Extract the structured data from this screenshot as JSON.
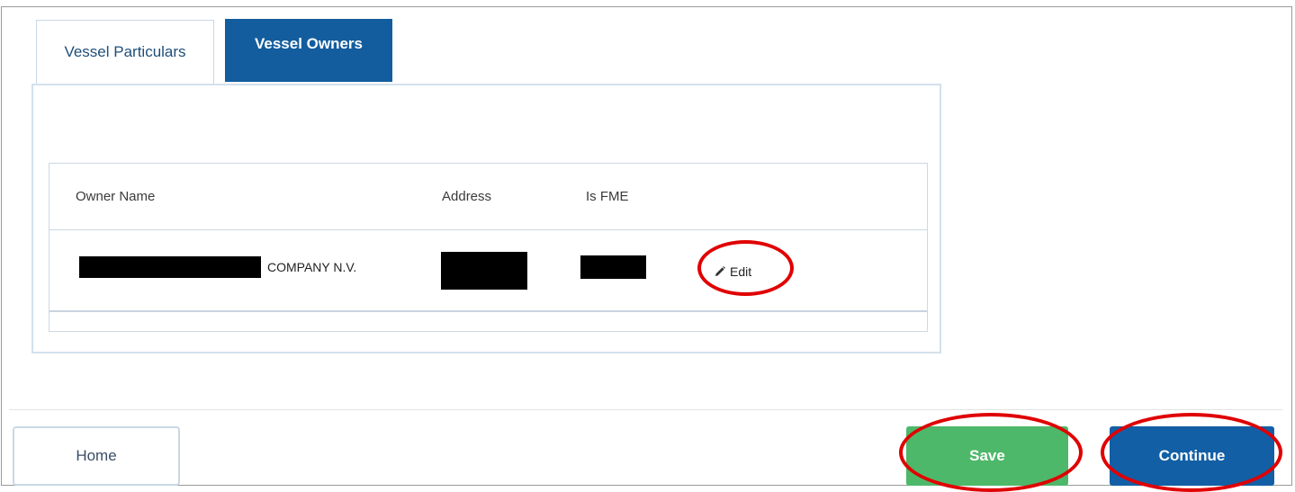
{
  "tabs": [
    {
      "label": "Vessel Particulars",
      "active": false
    },
    {
      "label": "Vessel Owners",
      "active": true
    }
  ],
  "owners_table": {
    "columns": [
      "Owner Name",
      "Address",
      "Is FME"
    ],
    "rows": [
      {
        "owner_name_visible": "COMPANY N.V.",
        "action_label": "Edit",
        "action_icon": "pencil-icon"
      }
    ]
  },
  "footer": {
    "home_label": "Home",
    "save_label": "Save",
    "continue_label": "Continue"
  },
  "colors": {
    "tab_active": "#135d9e",
    "save": "#4db86a",
    "continue": "#125fa6",
    "highlight": "#e00000"
  }
}
